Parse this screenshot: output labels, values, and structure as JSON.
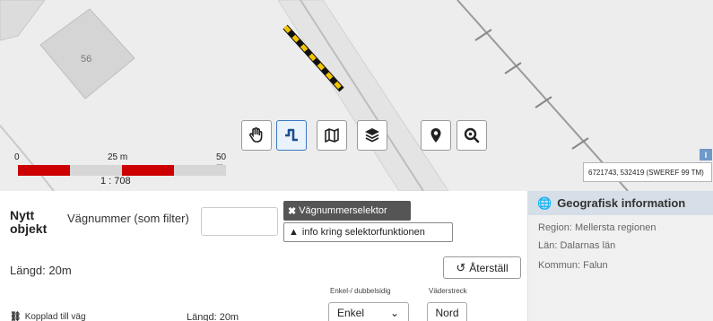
{
  "map": {
    "building_label": "56",
    "scale": {
      "labels": [
        "0",
        "25 m",
        "50 m"
      ],
      "ratio": "1 : 708"
    },
    "coordinates": "6721743, 532419 (SWEREF 99 TM)",
    "info_tag": "I",
    "tools": [
      {
        "name": "pan-tool",
        "icon": "hand-icon",
        "active": false
      },
      {
        "name": "road-select-tool",
        "icon": "road-segment-icon",
        "active": true
      },
      {
        "name": "map-layers-tool",
        "icon": "map-icon",
        "active": false
      },
      {
        "name": "layers-tool",
        "icon": "stack-icon",
        "active": false
      },
      {
        "name": "marker-tool",
        "icon": "location-pin-icon",
        "active": false
      },
      {
        "name": "search-location-tool",
        "icon": "search-pin-icon",
        "active": false
      }
    ],
    "colors": {
      "scale_red": "#cc0000",
      "road_highlight": "#f2c400",
      "active_tool": "#3b78c2"
    }
  },
  "panel": {
    "title": "Nytt objekt",
    "filter_label": "Vägnummer (som filter)",
    "filter_value": "",
    "selector_button": "Vägnummerselektor",
    "info_button": "info kring selektorfunktionen",
    "length": "Längd: 20m",
    "reset_button": "Återställ",
    "col_single_double": "Enkel-/ dubbelsidig",
    "col_direction": "Väderstreck",
    "linked_label": "Kopplad till väg",
    "linked_length": "Längd: 20m",
    "side_value": "Enkel",
    "direction_value": "Nord"
  },
  "geo": {
    "title": "Geografisk information",
    "region": "Region: Mellersta regionen",
    "county": "Län: Dalarnas län",
    "municipality": "Kommun: Falun"
  }
}
